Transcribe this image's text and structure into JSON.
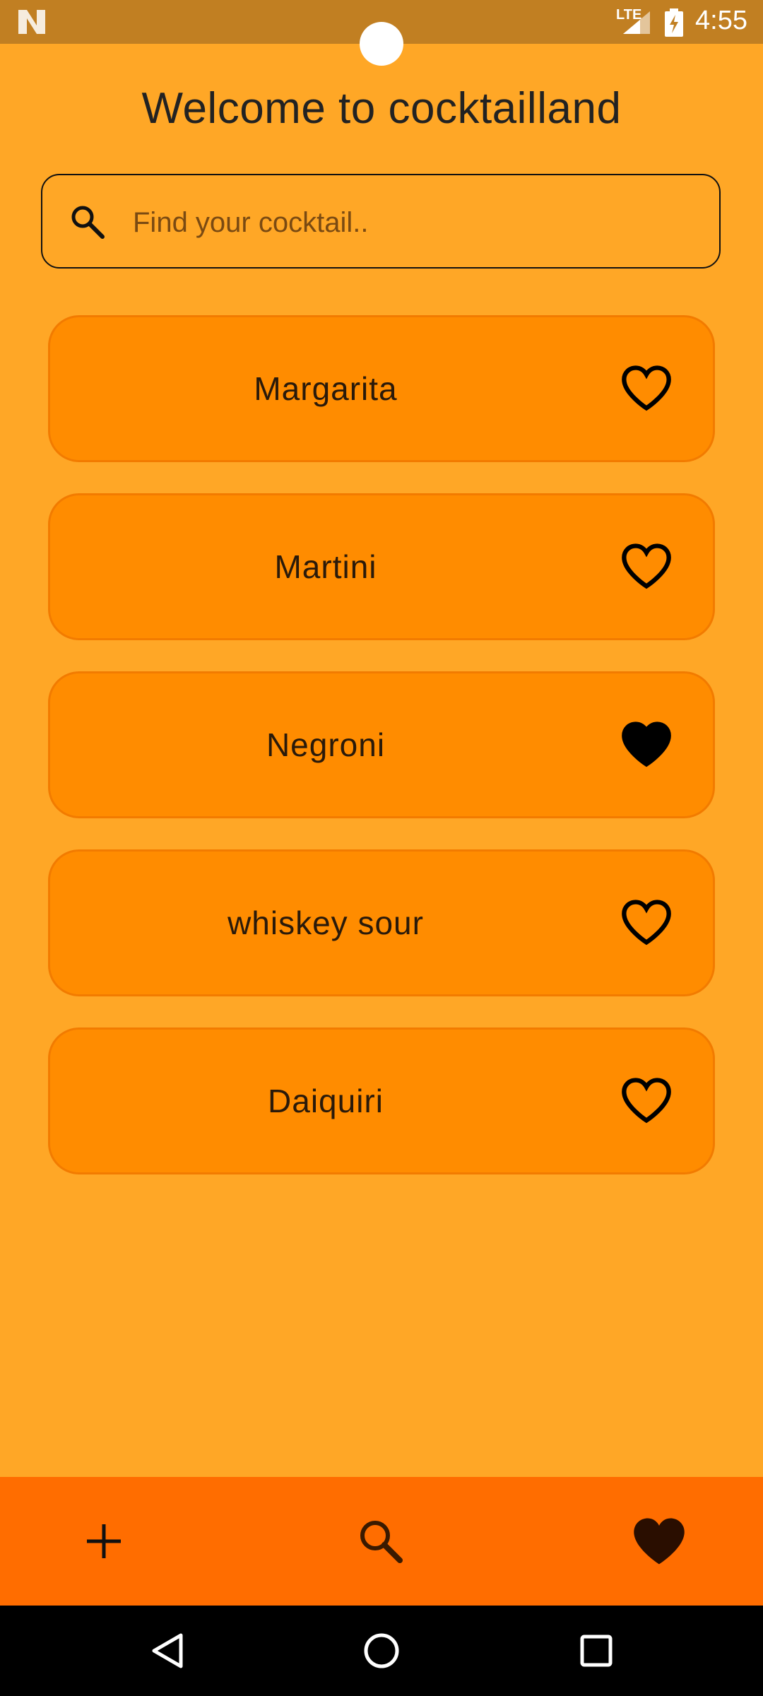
{
  "status_bar": {
    "network": "LTE",
    "time": "4:55"
  },
  "header": {
    "title": "Welcome to cocktailland"
  },
  "search": {
    "placeholder": "Find your cocktail..",
    "value": ""
  },
  "cocktails": [
    {
      "name": "Margarita",
      "favorite": false
    },
    {
      "name": "Martini",
      "favorite": false
    },
    {
      "name": "Negroni",
      "favorite": true
    },
    {
      "name": "whiskey sour",
      "favorite": false
    },
    {
      "name": "Daiquiri",
      "favorite": false
    }
  ],
  "bottom_nav": {
    "items": [
      {
        "icon": "plus-icon"
      },
      {
        "icon": "search-icon"
      },
      {
        "icon": "heart-icon"
      }
    ]
  },
  "colors": {
    "background": "#FFA726",
    "card": "#FF8C00",
    "bottom_nav": "#FF6D00",
    "status_bar": "#C17F22"
  }
}
